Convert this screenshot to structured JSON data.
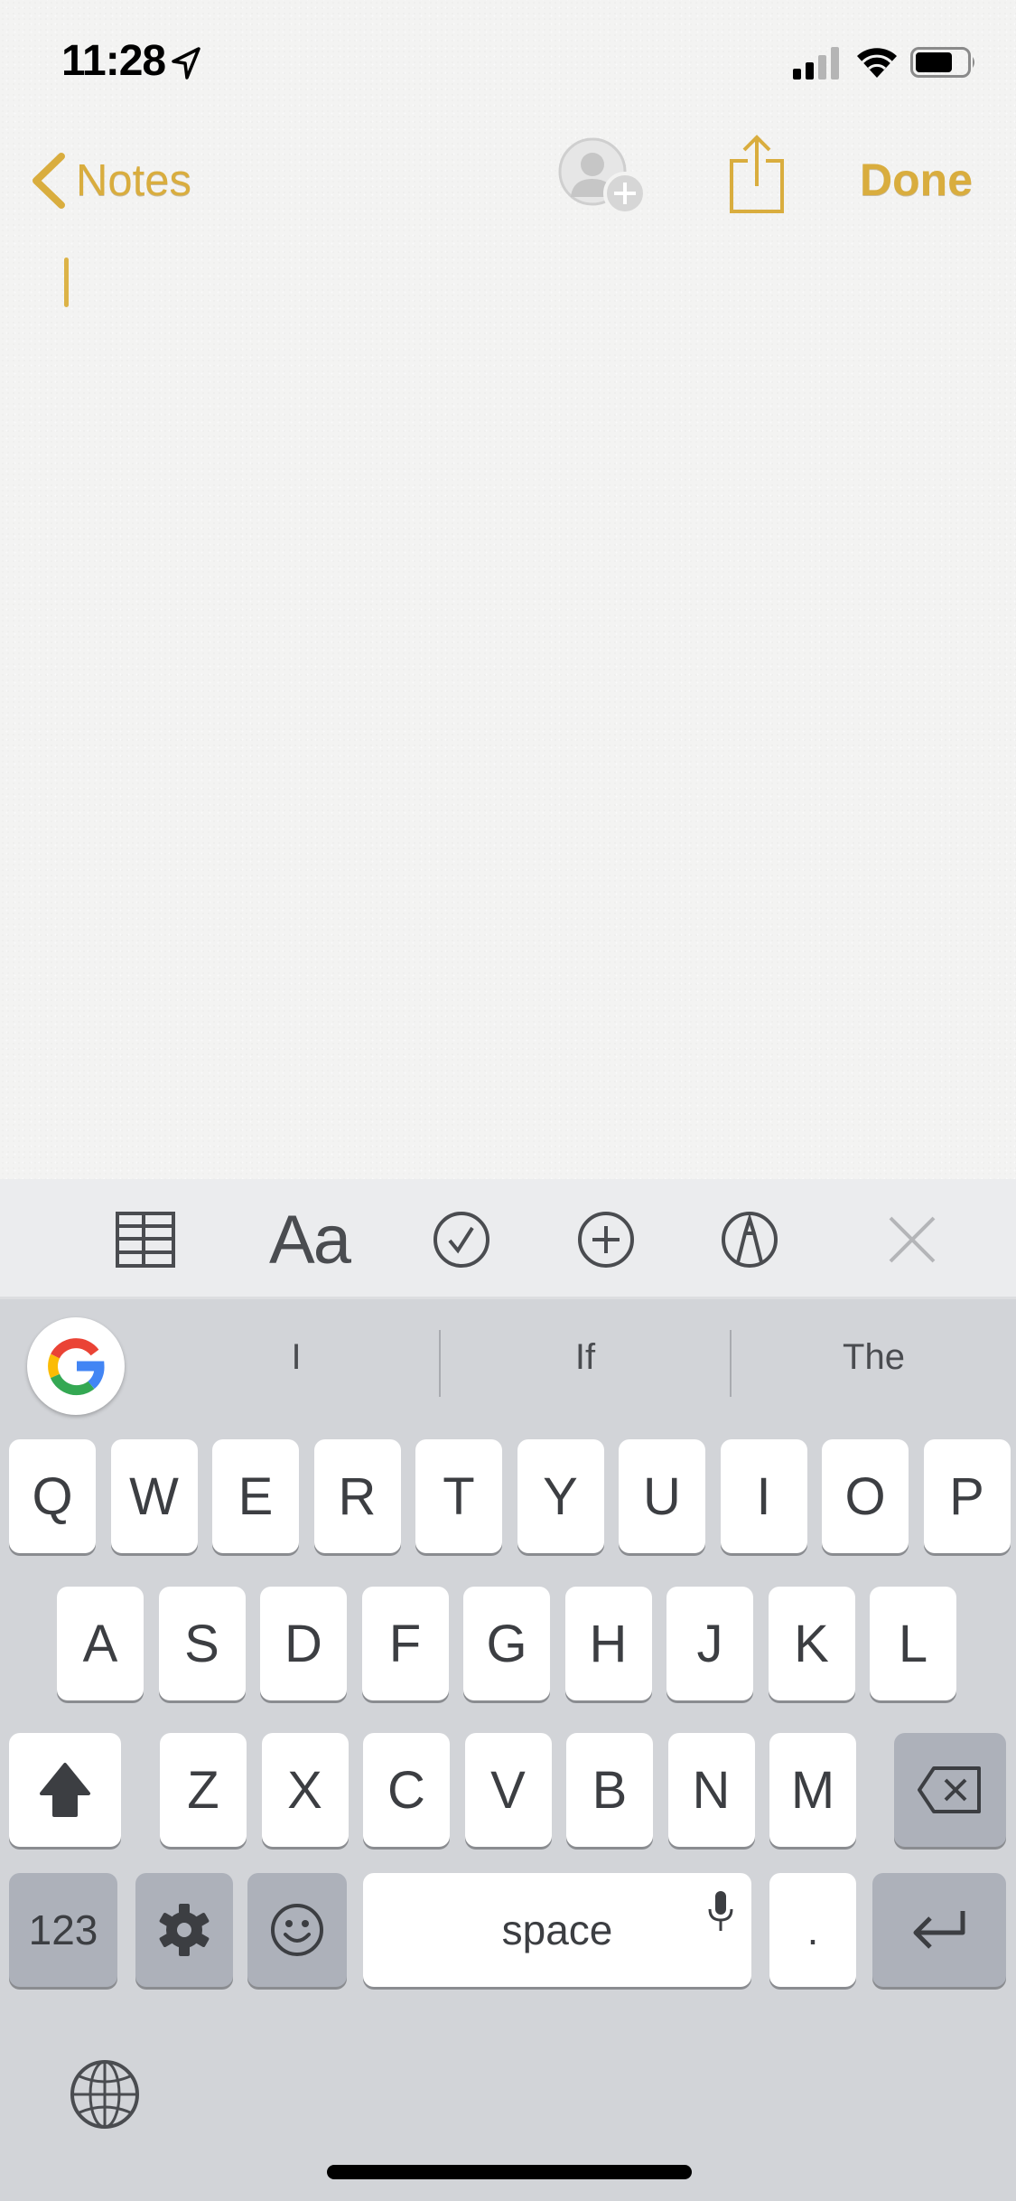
{
  "status_bar": {
    "time": "11:28",
    "icons": [
      "location-arrow-icon",
      "cellular-signal-icon",
      "wifi-icon",
      "battery-icon"
    ]
  },
  "nav": {
    "back_label": "Notes",
    "done_label": "Done",
    "icons": [
      "chevron-left-icon",
      "add-collaborator-icon",
      "share-icon"
    ]
  },
  "colors": {
    "accent": "#d9ad3e",
    "keyboard_bg": "#d2d4d8",
    "toolbar_bg": "#ebecee",
    "key_dark": "#adb1ba",
    "key_text": "#3c3e42"
  },
  "note": {
    "content": ""
  },
  "toolbar": {
    "format_label": "Aa",
    "items": [
      "table-icon",
      "text-format-icon",
      "checklist-icon",
      "add-icon",
      "markup-pen-icon",
      "close-icon"
    ]
  },
  "keyboard": {
    "suggestions": [
      "I",
      "If",
      "The"
    ],
    "row1": [
      "Q",
      "W",
      "E",
      "R",
      "T",
      "Y",
      "U",
      "I",
      "O",
      "P"
    ],
    "row2": [
      "A",
      "S",
      "D",
      "F",
      "G",
      "H",
      "J",
      "K",
      "L"
    ],
    "row3": [
      "Z",
      "X",
      "C",
      "V",
      "B",
      "N",
      "M"
    ],
    "numbers_label": "123",
    "space_label": "space",
    "period_label": "."
  }
}
